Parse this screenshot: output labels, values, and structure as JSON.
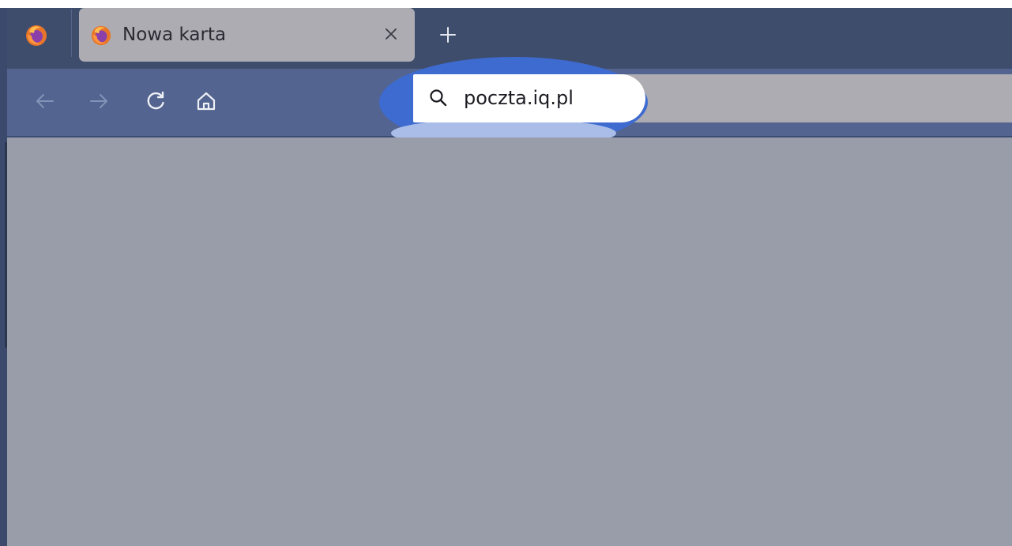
{
  "tab": {
    "title": "Nowa karta",
    "favicon": "firefox-icon"
  },
  "toolbar": {
    "back": "arrow-left-icon",
    "forward": "arrow-right-icon",
    "reload": "reload-icon",
    "home": "home-icon",
    "new_tab": "plus-icon",
    "close_tab": "close-icon"
  },
  "urlbar": {
    "value": "poczta.iq.pl"
  },
  "colors": {
    "tabstrip": "#3f4d6d",
    "navbar": "#52648f",
    "content": "#989da9",
    "highlight": "#3e6bd0"
  }
}
